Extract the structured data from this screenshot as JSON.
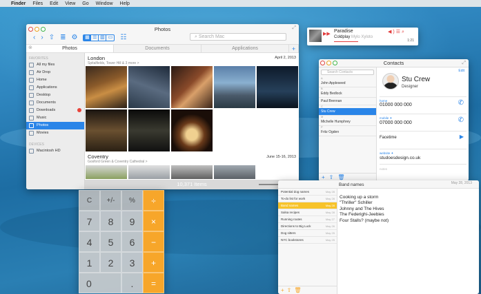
{
  "menubar": {
    "app": "Finder",
    "items": [
      "Files",
      "Edit",
      "View",
      "Go",
      "Window",
      "Help"
    ]
  },
  "photos": {
    "title": "Photos",
    "search_placeholder": "Search Mac",
    "tabs": [
      "Photos",
      "Documents",
      "Applications"
    ],
    "sidebar": {
      "favorites_header": "FAVORITES",
      "items": [
        "All my files",
        "Air Drop",
        "Home",
        "Applications",
        "Desktop",
        "Documents",
        "Downloads",
        "Music",
        "Photos",
        "Movies"
      ],
      "devices_header": "DEVICES",
      "devices": [
        "Macintosh HD"
      ]
    },
    "album1": {
      "title": "London",
      "subtitle": "Spitalfields, Tower Hill & 3 more >",
      "date": "April 2, 2013"
    },
    "album2": {
      "title": "Coventry",
      "subtitle": "Gosford Green & Coventry Cathedral >",
      "date": "June 15-16, 2013"
    },
    "item_count": "10,371 Items"
  },
  "music": {
    "song": "Paradise",
    "artist": "Coldplay",
    "album": "Mylo Xyloto",
    "time": "1:21",
    "progress": 0.35
  },
  "contacts": {
    "title": "Contacts",
    "search_placeholder": "Search Contacts",
    "letters": [
      "A",
      "B",
      "C",
      "M",
      "P"
    ],
    "list": [
      "John Appleseed",
      "Eddy Bedlock",
      "Paul Brennan",
      "Stu Crew",
      "Michelle Humphrey",
      "Fritz Ogden"
    ],
    "edit_label": "Edit",
    "name": "Stu Crew",
    "role": "Designer",
    "home_label": "home",
    "home": "01000 000 000",
    "mobile_label": "mobile ✦",
    "mobile": "07000 000 000",
    "facetime_label": "Facetime",
    "website_label": "website ✦",
    "website": "studoesdesign.co.uk",
    "notes_label": "notes"
  },
  "notes": {
    "date": "May 28, 2013",
    "list": [
      {
        "title": "Potential dog names",
        "date": "May 28"
      },
      {
        "title": "To-do list for work",
        "date": "May 28"
      },
      {
        "title": "Band names",
        "date": "May 28"
      },
      {
        "title": "Salsa recipes",
        "date": "May 28"
      },
      {
        "title": "Running routes",
        "date": "May 27"
      },
      {
        "title": "Directions to Big Luck",
        "date": "May 26"
      },
      {
        "title": "Dog sitters",
        "date": "May 25"
      },
      {
        "title": "NYC bookstores",
        "date": "May 25"
      }
    ],
    "title": "Band names",
    "lines": [
      "Cooking up a storm",
      "\"Thriller\" Schiller",
      "Johnny and The Hives",
      "The Federighi-Jeebies",
      "Four Stalls? (maybe not)"
    ]
  },
  "calculator": {
    "rows": [
      [
        "C",
        "+/-",
        "%",
        "÷"
      ],
      [
        "7",
        "8",
        "9",
        "×"
      ],
      [
        "4",
        "5",
        "6",
        "−"
      ],
      [
        "1",
        "2",
        "3",
        "+"
      ],
      [
        "0",
        ".",
        "="
      ]
    ]
  },
  "colors": {
    "accent": "#2a85e8",
    "orange": "#f7a62a",
    "notes_sel": "#f7c32a",
    "music_red": "#e23b3b"
  }
}
